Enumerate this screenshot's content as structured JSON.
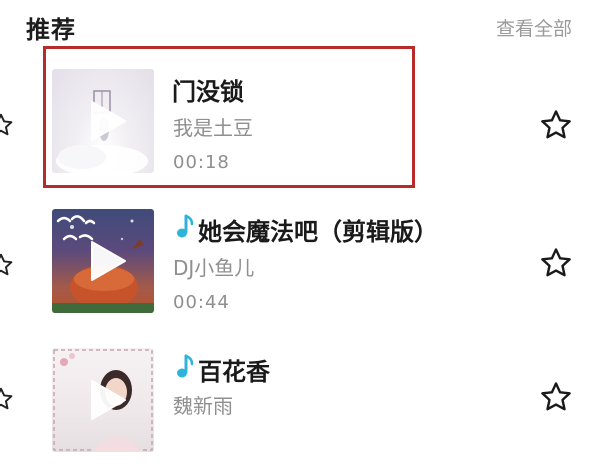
{
  "header": {
    "title": "推荐",
    "see_all": "查看全部"
  },
  "songs": [
    {
      "title": "门没锁",
      "artist": "我是土豆",
      "duration": "00:18",
      "has_note_icon": false,
      "selected": true
    },
    {
      "title": "她会魔法吧（剪辑版）",
      "artist": "DJ小鱼儿",
      "duration": "00:44",
      "has_note_icon": true,
      "selected": false
    },
    {
      "title": "百花香",
      "artist": "魏新雨",
      "duration": "",
      "has_note_icon": true,
      "selected": false
    }
  ],
  "colors": {
    "highlight_border": "#b72b2b",
    "note_icon": "#2fb4d8",
    "secondary_text": "#8f8f8f"
  },
  "icons": {
    "favorite": "star-outline-icon",
    "play": "play-icon",
    "note": "music-note-icon"
  }
}
